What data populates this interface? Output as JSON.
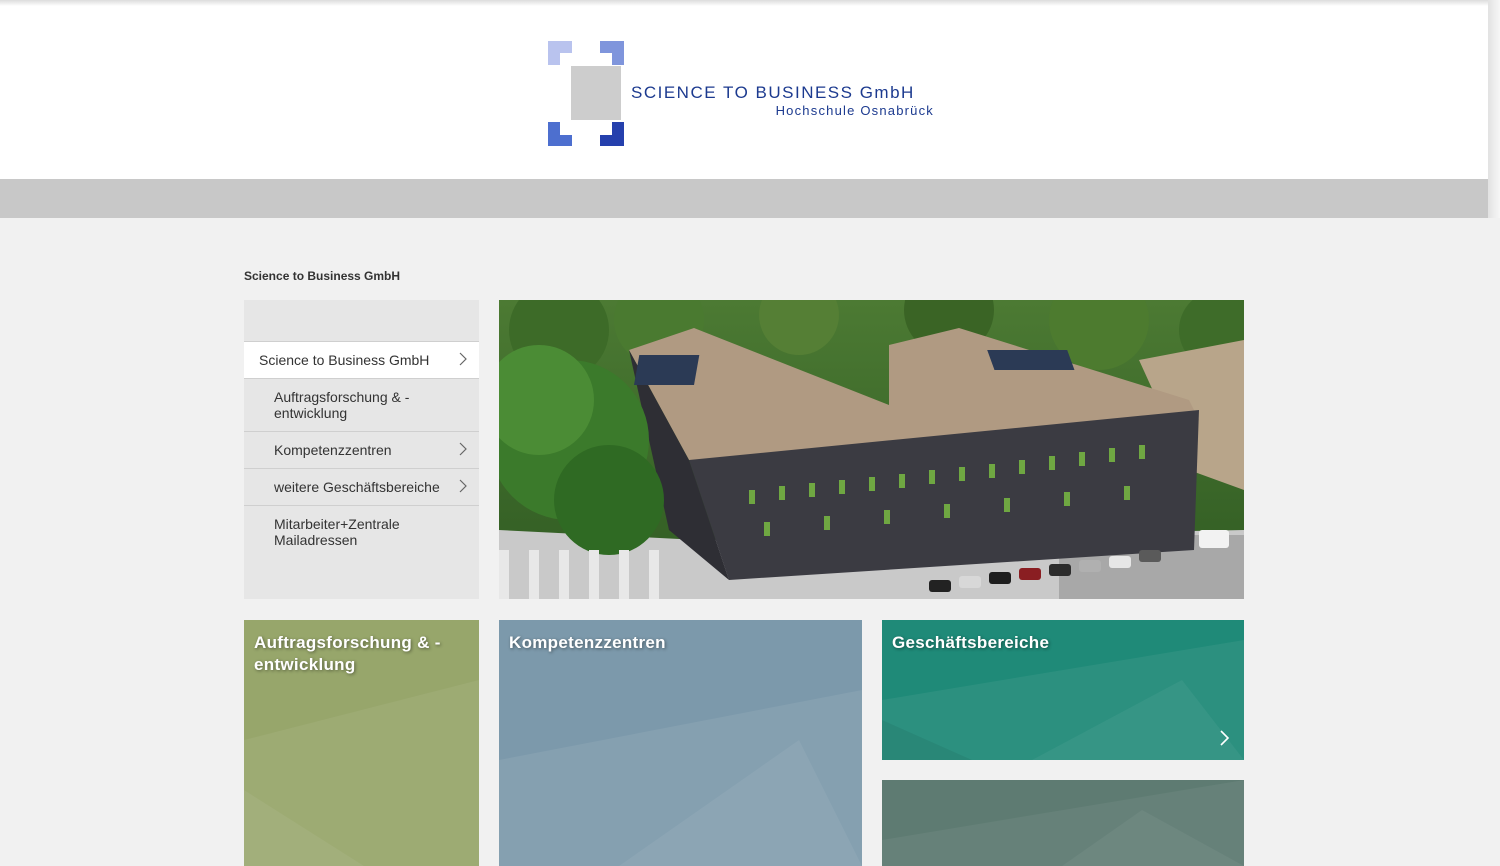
{
  "header": {
    "logo_title": "SCIENCE TO BUSINESS GmbH",
    "logo_subtitle": "Hochschule Osnabrück"
  },
  "page": {
    "heading": "Science to Business GmbH"
  },
  "sidenav": {
    "items": [
      {
        "label": "Science to Business GmbH",
        "has_children": true,
        "active": true
      },
      {
        "label": "Auftragsforschung & -entwicklung",
        "has_children": false,
        "active": false
      },
      {
        "label": "Kompetenzzentren",
        "has_children": true,
        "active": false
      },
      {
        "label": "weitere Geschäftsbereiche",
        "has_children": true,
        "active": false
      },
      {
        "label": "Mitarbeiter+Zentrale Mailadressen",
        "has_children": false,
        "active": false
      }
    ]
  },
  "tiles": [
    {
      "title": "Auftragsforschung & -entwicklung",
      "color": "#97a66b"
    },
    {
      "title": "Kompetenzzentren",
      "color": "#7c99ab"
    },
    {
      "title": "Geschäftsbereiche",
      "color": "#1f8a78"
    },
    {
      "title": "",
      "color": "#5e7b72"
    }
  ],
  "colors": {
    "brand_blue": "#1c3a8f",
    "navbar_gray": "#c8c8c8",
    "sidenav_bg": "#e6e6e6"
  },
  "icons": {
    "chevron": "chevron-right-icon"
  }
}
